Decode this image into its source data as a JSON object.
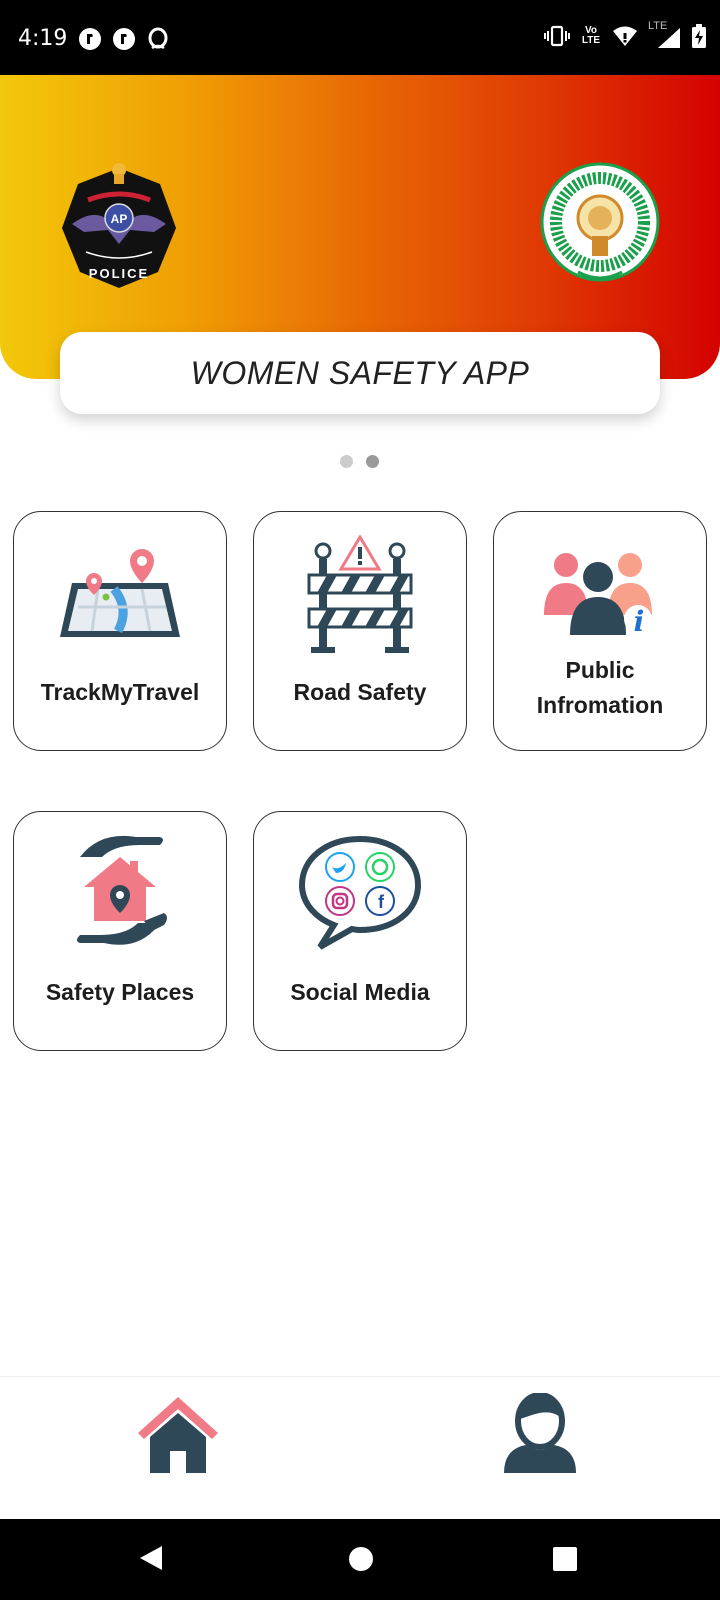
{
  "status_bar": {
    "time": "4:19",
    "left_icons": [
      "notification-icon",
      "notification-icon",
      "opera-icon"
    ],
    "right_icons": [
      "vibrate-icon",
      "volte-icon",
      "wifi-icon",
      "lte-signal-icon",
      "battery-charging-icon"
    ],
    "volte_label": "Vo LTE",
    "lte_label": "LTE"
  },
  "header": {
    "title": "WOMEN SAFETY APP",
    "gradient_colors": [
      "#f2c80a",
      "#d40200"
    ],
    "left_logo": "ap-police-logo",
    "right_logo": "andhra-pradesh-emblem"
  },
  "carousel": {
    "page_count": 2,
    "active_page": 2
  },
  "tiles": [
    {
      "label": "TrackMyTravel",
      "icon": "map-pin-icon"
    },
    {
      "label": "Road Safety",
      "icon": "barricade-icon"
    },
    {
      "label": "Public Infromation",
      "label_line1": "Public",
      "label_line2": "Infromation",
      "icon": "public-info-icon"
    },
    {
      "label": "Safety Places",
      "icon": "safe-home-icon"
    },
    {
      "label": "Social Media",
      "icon": "social-media-icon"
    }
  ],
  "bottom_nav": {
    "items": [
      "home-icon",
      "profile-icon"
    ],
    "active": "home-icon"
  },
  "system_nav": [
    "back-button",
    "home-button",
    "recents-button"
  ],
  "colors": {
    "accent_dark": "#2f4858",
    "accent_pink": "#f07a85",
    "tile_border": "#333333"
  }
}
